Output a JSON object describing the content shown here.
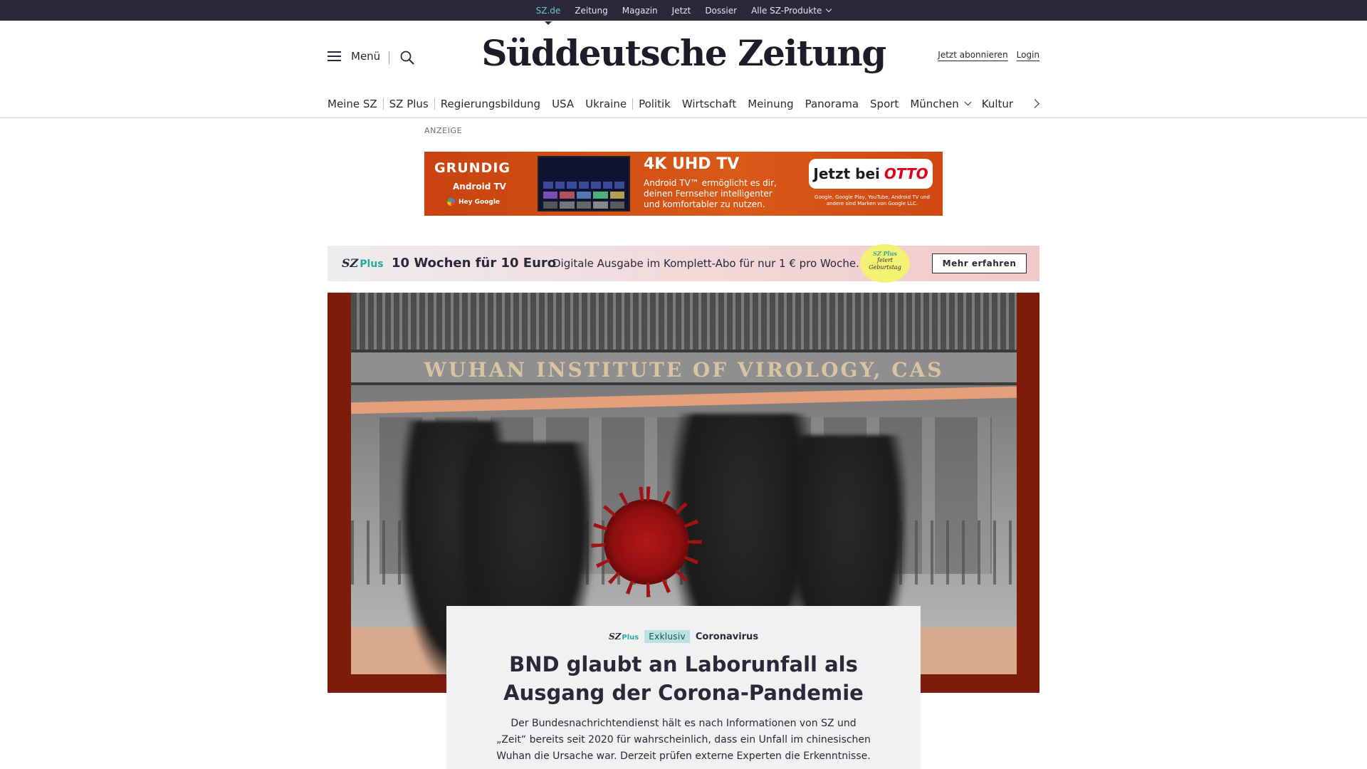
{
  "topbar": {
    "links": [
      "SZ.de",
      "Zeitung",
      "Magazin",
      "Jetzt",
      "Dossier",
      "Alle SZ-Produkte"
    ]
  },
  "header": {
    "menu_label": "Menü",
    "logo": "Süddeutsche Zeitung",
    "subscribe": "Jetzt abonnieren",
    "login": "Login"
  },
  "nav": {
    "items": [
      "Meine SZ",
      "SZ Plus",
      "Regierungsbildung",
      "USA",
      "Ukraine",
      "Politik",
      "Wirtschaft",
      "Meinung",
      "Panorama",
      "Sport",
      "München",
      "Kultur"
    ]
  },
  "ad": {
    "label": "ANZEIGE",
    "brand": "GRUNDIG",
    "platform": "Android TV",
    "assistant": "Hey Google",
    "headline": "4K UHD TV",
    "copy": "Android TV™ ermöglicht es dir, deinen Fernseher intelligenter und komfortabler zu nutzen.",
    "cta_prefix": "Jetzt bei",
    "cta_brand": "OTTO",
    "fineprint": "Google, Google Play, YouTube, Android TV und andere sind Marken von Google LLC."
  },
  "plus_banner": {
    "logo": "SZ",
    "logo_suffix": "Plus",
    "title": "10 Wochen für 10 Euro",
    "subtitle": "Digitale Ausgabe im Komplett-Abo für nur 1 € pro Woche.",
    "badge_line1": "SZ Plus",
    "badge_line2": "feiert",
    "badge_line3": "Geburtstag",
    "button": "Mehr erfahren"
  },
  "hero": {
    "sign_text": "WUHAN INSTITUTE OF VIROLOGY, CAS"
  },
  "article": {
    "szplus": "SZ",
    "szplus_suffix": "Plus",
    "badge": "Exklusiv",
    "topic": "Coronavirus",
    "title": "BND glaubt an Laborunfall als Ausgang der Corona-Pandemie",
    "teaser": "Der Bundesnachrichtendienst hält es nach Informationen von SZ und „Zeit“ bereits seit 2020 für wahrscheinlich, dass ein Unfall im chinesischen Wuhan die Ursache war. Derzeit prüfen externe Experten die Erkenntnisse."
  },
  "colors": {
    "dark": "#29293a",
    "accent": "#71c3c6",
    "plus_teal": "#27a8a5",
    "hero_frame": "#7e1c0c",
    "otto_red": "#e0001b"
  }
}
